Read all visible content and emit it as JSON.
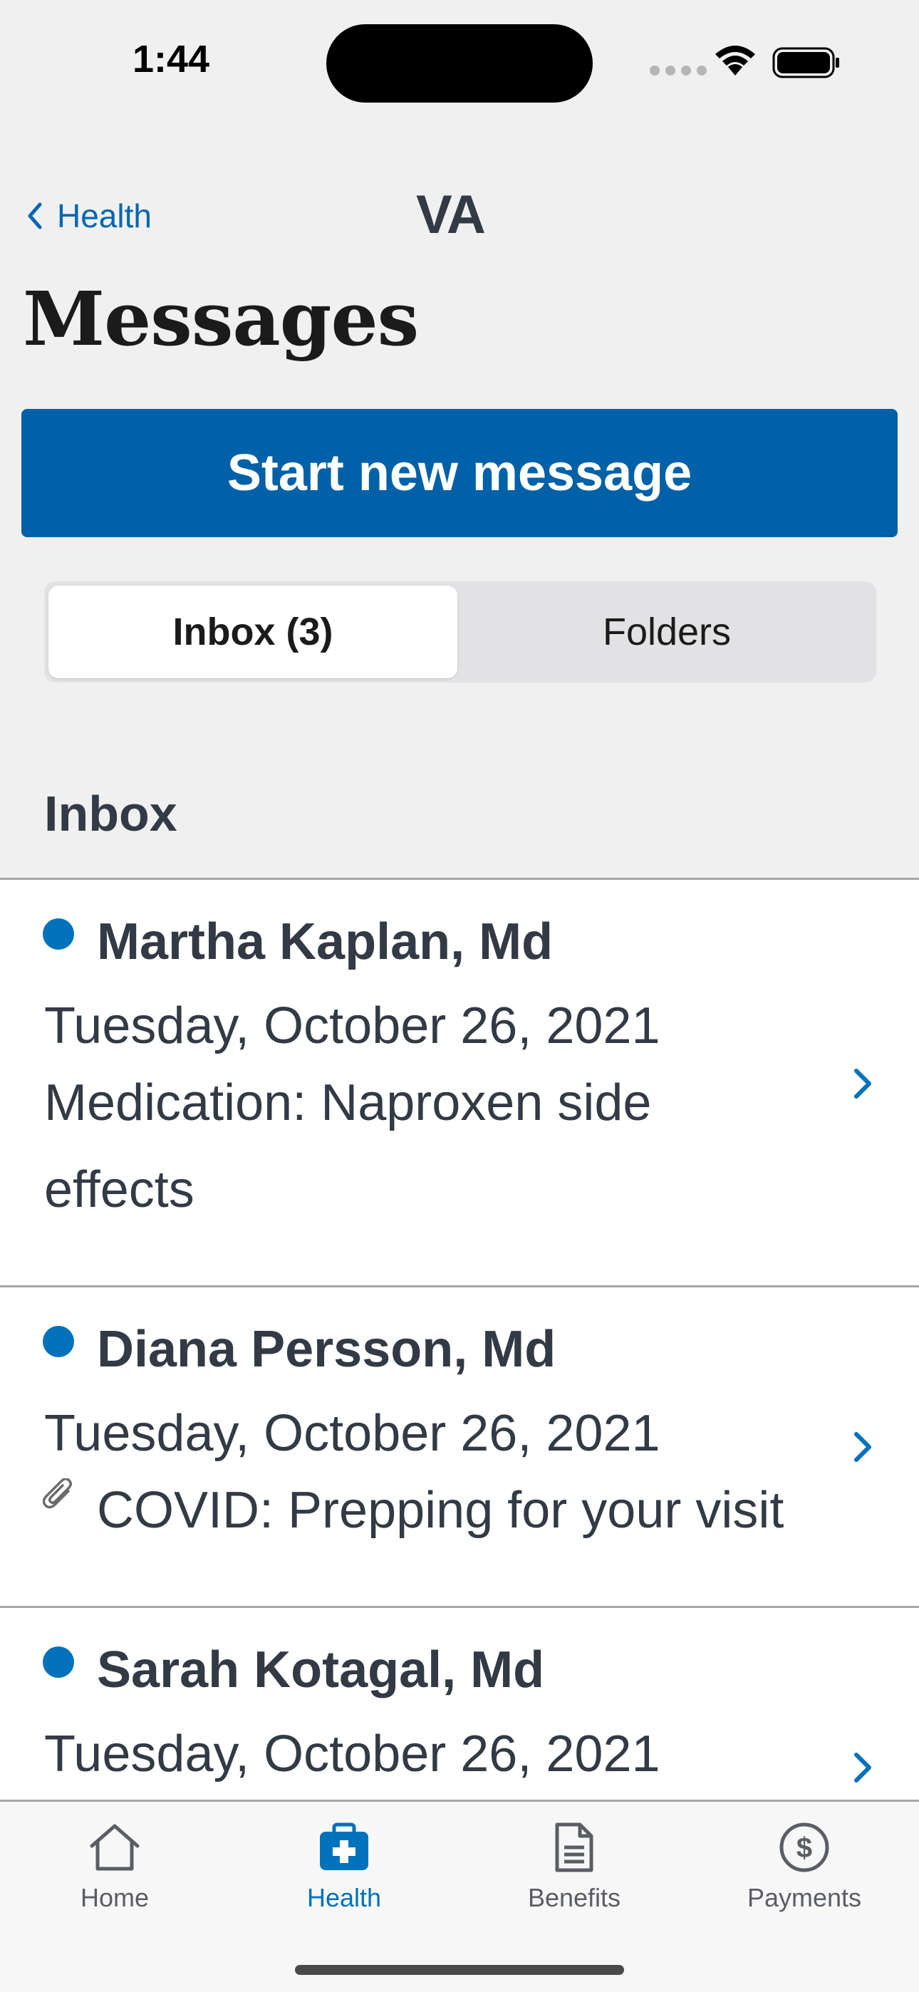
{
  "status": {
    "time": "1:44"
  },
  "nav": {
    "back_label": "Health",
    "logo": "VA"
  },
  "page": {
    "title": "Messages"
  },
  "actions": {
    "start_new_message": "Start new message"
  },
  "segmented": {
    "inbox_label": "Inbox (3)",
    "folders_label": "Folders",
    "selected": "inbox"
  },
  "inbox": {
    "heading": "Inbox",
    "messages": [
      {
        "sender": "Martha Kaplan, Md",
        "date": "Tuesday, October 26, 2021",
        "subject": "Medication: Naproxen side effects",
        "unread": true,
        "attachment": false
      },
      {
        "sender": "Diana Persson, Md",
        "date": "Tuesday, October 26, 2021",
        "subject": "COVID: Prepping for your visit",
        "unread": true,
        "attachment": true
      },
      {
        "sender": "Sarah Kotagal, Md",
        "date": "Tuesday, October 26, 2021",
        "subject": "",
        "unread": true,
        "attachment": false
      }
    ]
  },
  "tabbar": {
    "items": [
      {
        "label": "Home",
        "icon": "home-icon"
      },
      {
        "label": "Health",
        "icon": "medical-bag-icon",
        "active": true
      },
      {
        "label": "Benefits",
        "icon": "document-icon"
      },
      {
        "label": "Payments",
        "icon": "dollar-circle-icon"
      }
    ]
  },
  "colors": {
    "primary": "#0061a8",
    "accent": "#0071bb",
    "text": "#323a45",
    "background": "#f0f0f0"
  }
}
